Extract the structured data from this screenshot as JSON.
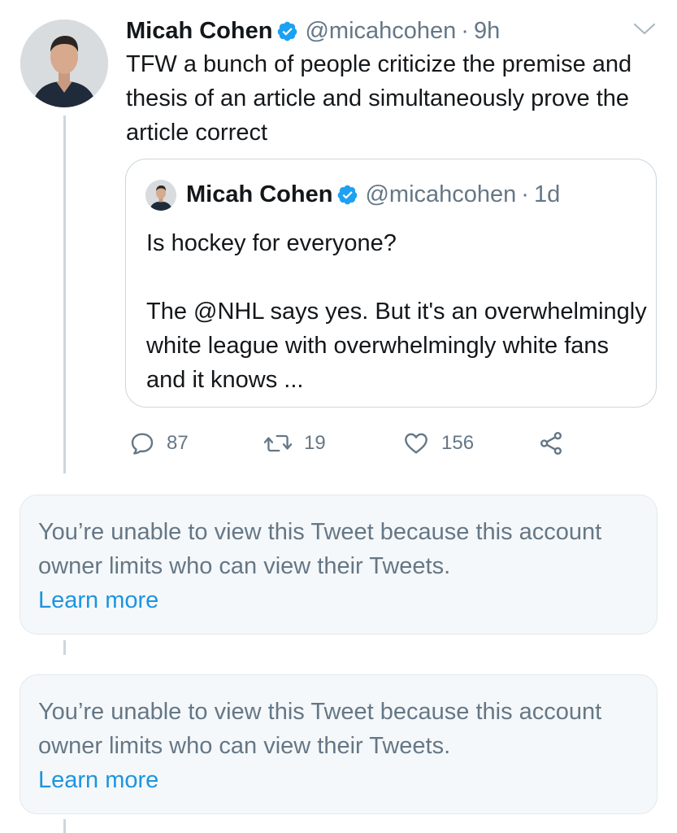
{
  "tweet": {
    "display_name": "Micah Cohen",
    "handle": "@micahcohen",
    "separator": "·",
    "time": "9h",
    "text": "TFW a bunch of people criticize the premise and thesis of an article and simultaneously prove the article correct",
    "quoted": {
      "display_name": "Micah Cohen",
      "handle": "@micahcohen",
      "separator": "·",
      "time": "1d",
      "text_line1": "Is hockey for everyone?",
      "text_line2": "The @NHL says yes. But it's an overwhelmingly white league with overwhelmingly white fans and it knows ..."
    },
    "actions": {
      "reply_count": "87",
      "retweet_count": "19",
      "like_count": "156"
    }
  },
  "restricted_notices": [
    {
      "message": "You’re unable to view this Tweet because this account owner limits who can view their Tweets.",
      "link": "Learn more"
    },
    {
      "message": "You’re unable to view this Tweet because this account owner limits who can view their Tweets.",
      "link": "Learn more"
    }
  ],
  "icons": {
    "verified": "verified-badge-icon",
    "chevron": "chevron-down-icon",
    "reply": "reply-icon",
    "retweet": "retweet-icon",
    "like": "heart-icon",
    "share": "share-icon"
  },
  "colors": {
    "accent": "#1da1f2",
    "link": "#1b95e0",
    "secondary_text": "#657786",
    "thread_line": "#ccd6dd",
    "notice_background": "#f5f8fa"
  }
}
